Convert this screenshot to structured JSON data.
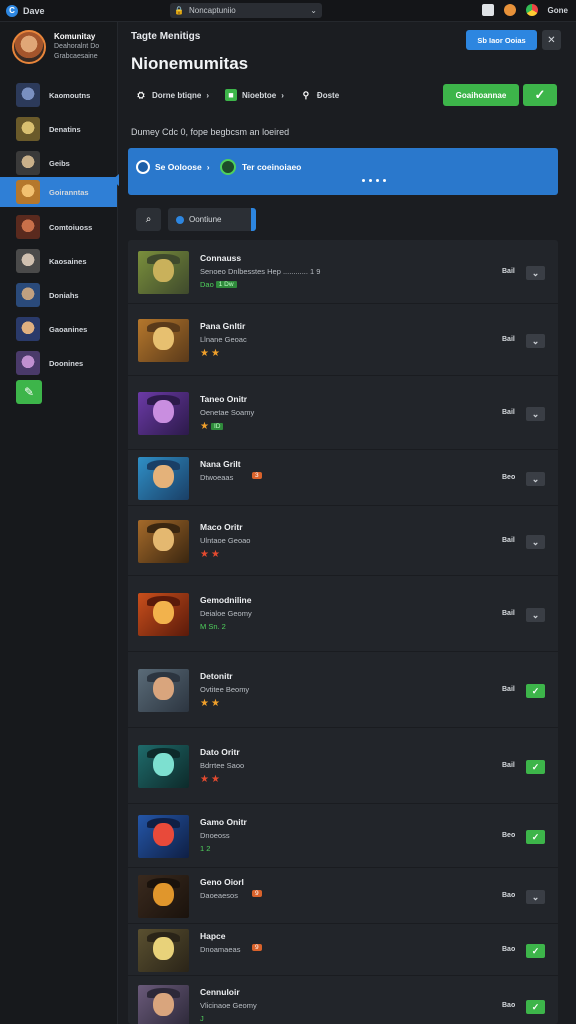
{
  "topbar": {
    "brand": "Dave",
    "address": "Noncaptuniio",
    "right_label": "Gone",
    "colors": {
      "brand": "#2d86e0"
    }
  },
  "sidebar": {
    "profile": {
      "name": "Komunitay",
      "line1": "Deahoralnt Do",
      "line2": "Grabcaesaine"
    },
    "items": [
      {
        "label": "Kaomoutns",
        "icon": "game-avatar-1"
      },
      {
        "label": "Denatins",
        "icon": "game-avatar-2"
      },
      {
        "label": "Geibs",
        "icon": "game-avatar-3"
      },
      {
        "label": "Goiranntas",
        "icon": "game-avatar-4",
        "active": true
      },
      {
        "label": "Comtoiuoss",
        "icon": "game-avatar-5"
      },
      {
        "label": "Kaosaines",
        "icon": "game-avatar-6"
      },
      {
        "label": "Doniahs",
        "icon": "game-avatar-7"
      },
      {
        "label": "Gaoanines",
        "icon": "game-avatar-8"
      },
      {
        "label": "Doonines",
        "icon": "game-avatar-9"
      }
    ]
  },
  "header": {
    "breadcrumb": "Tagte Menitigs",
    "title": "Nionemumitas",
    "primary_button": "Sb Iaor Ooias",
    "filters": [
      {
        "label": "Dorne btiqne",
        "icon": "controller-icon"
      },
      {
        "label": "Nioebtoe",
        "icon": "tag-icon"
      },
      {
        "label": "Ðoste",
        "icon": "user-icon"
      }
    ],
    "green_button": "Goaihoannae",
    "subline": "Dumey Cdc 0, fope begbcsm an loeired"
  },
  "banner": {
    "left_label": "Se Ooloose",
    "right_label": "Ter coeinoiaeo"
  },
  "toolbar": {
    "toggle_label": "Oontiune"
  },
  "games": [
    {
      "title": "Connauss",
      "sub": "Senoeo Dnlbesstes Hep ............ 1 9",
      "meta": "Dao",
      "badge": "1 Dw",
      "status": "Bail",
      "checked": false,
      "palette": [
        "#7a8f3c",
        "#c9b15b",
        "#3f4a2c"
      ]
    },
    {
      "title": "Pana Gnltir",
      "sub": "Llnane Geoac",
      "stars": 2,
      "starColor": "orange",
      "status": "Bail",
      "checked": false,
      "palette": [
        "#b5772c",
        "#e7c070",
        "#5a3a1a"
      ]
    },
    {
      "title": "Taneo Onitr",
      "sub": "Oenetae Soamy",
      "stars": 1,
      "starColor": "orange",
      "badge": "ID",
      "status": "Bail",
      "checked": false,
      "palette": [
        "#6b3aa6",
        "#c98ee0",
        "#2c1a4a"
      ]
    },
    {
      "title": "Nana Grilt",
      "sub": "Dtwoeaas",
      "badge_o": "3",
      "status": "Beo",
      "checked": false,
      "palette": [
        "#2f8fc6",
        "#e4b27a",
        "#1a3f66"
      ]
    },
    {
      "title": "Maco Oritr",
      "sub": "Ulntaoe Geoao",
      "stars": 2,
      "starColor": "red",
      "status": "Bail",
      "checked": false,
      "palette": [
        "#a56a2a",
        "#e4b870",
        "#3a2610"
      ]
    },
    {
      "title": "Gemodniline",
      "sub": "Deialoe Geomy",
      "meta": "M Sn. 2",
      "status": "Bail",
      "checked": false,
      "palette": [
        "#c94f1c",
        "#f2b24c",
        "#5a1a0a"
      ]
    },
    {
      "title": "Detonitr",
      "sub": "Ovtitee Beomy",
      "stars": 2,
      "starColor": "orange",
      "status": "Bail",
      "checked": true,
      "palette": [
        "#5a6b78",
        "#d9a57d",
        "#2c3540"
      ]
    },
    {
      "title": "Dato Oritr",
      "sub": "Bdrrtee Saoo",
      "stars": 2,
      "starColor": "red",
      "status": "Bail",
      "checked": true,
      "palette": [
        "#1f6b6b",
        "#7de0d0",
        "#0d2a2a"
      ]
    },
    {
      "title": "Gamo Onitr",
      "sub": "Dnoeoss",
      "meta": "1 2",
      "status": "Beo",
      "checked": true,
      "palette": [
        "#2456a8",
        "#e84a3a",
        "#0f1f44"
      ]
    },
    {
      "title": "Geno Oiorl",
      "sub": "Daoeaesos",
      "badge_o": "9",
      "status": "Bao",
      "checked": false,
      "palette": [
        "#3a2a1e",
        "#e0962c",
        "#1a120c"
      ]
    },
    {
      "title": "Hapce",
      "sub": "Dnoamaeas",
      "badge_o": "9",
      "status": "Bao",
      "checked": true,
      "palette": [
        "#5a5030",
        "#e8d27a",
        "#2a2418"
      ]
    },
    {
      "title": "Cennuloir",
      "sub": "Vlicinaoe Geomy",
      "meta": "J",
      "status": "Bao",
      "checked": true,
      "palette": [
        "#6a5a7a",
        "#d9a57d",
        "#2c2838"
      ]
    }
  ]
}
